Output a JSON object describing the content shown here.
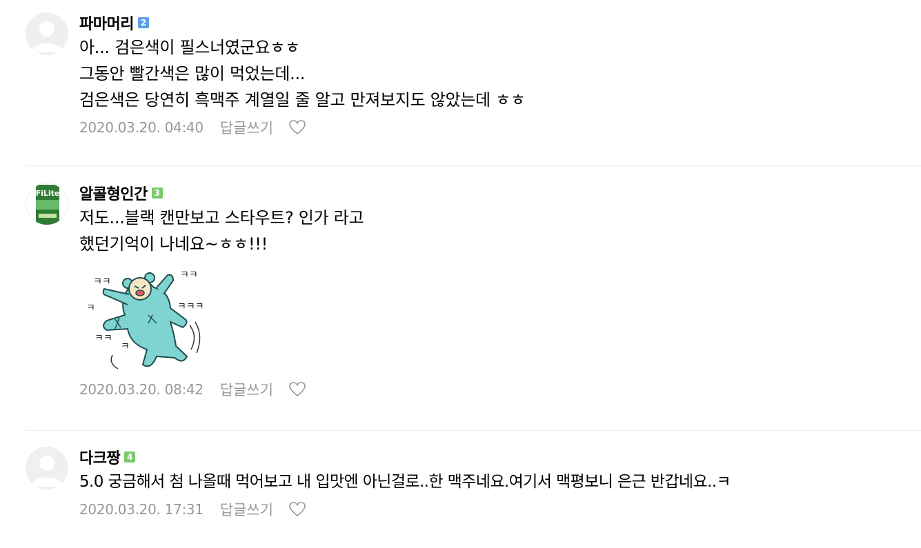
{
  "comments": [
    {
      "nickname": "파마머리",
      "level": "2",
      "level_color": "#5c9ef0",
      "lines": [
        "아... 검은색이 필스너였군요ㅎㅎ",
        "그동안 빨간색은 많이 먹었는데...",
        "검은색은 당연히 흑맥주 계열일 줄 알고 만져보지도 않았는데 ㅎㅎ"
      ],
      "date": "2020.03.20. 04:40",
      "reply_label": "답글쓰기",
      "avatar": "default-avatar"
    },
    {
      "nickname": "알콜형인간",
      "level": "3",
      "level_color": "#7cc96a",
      "lines": [
        "저도...블랙 캔만보고 스타우트? 인가 라고",
        "했던기억이 나네요~ㅎㅎ!!!"
      ],
      "sticker_labels": [
        "ㅋㅋ",
        "ㅋ",
        "ㅋㅋ",
        "ㅋㅋㅋ",
        "ㅋㅋ",
        "ㅋ"
      ],
      "date": "2020.03.20. 08:42",
      "reply_label": "답글쓰기",
      "avatar_text": "FiLite"
    },
    {
      "nickname": "다크짱",
      "level": "4",
      "level_color": "#7cc96a",
      "lines": [
        "5.0 궁금해서 첨 나올때 먹어보고 내 입맛엔 아닌걸로..한 맥주네요.여기서 맥평보니 은근 반갑네요..ㅋ"
      ],
      "date": "2020.03.20. 17:31",
      "reply_label": "답글쓰기",
      "avatar": "default-avatar"
    }
  ],
  "colors": {
    "meta_text": "#979797",
    "divider": "#ececec",
    "sticker_bear": "#7fd3d0"
  }
}
